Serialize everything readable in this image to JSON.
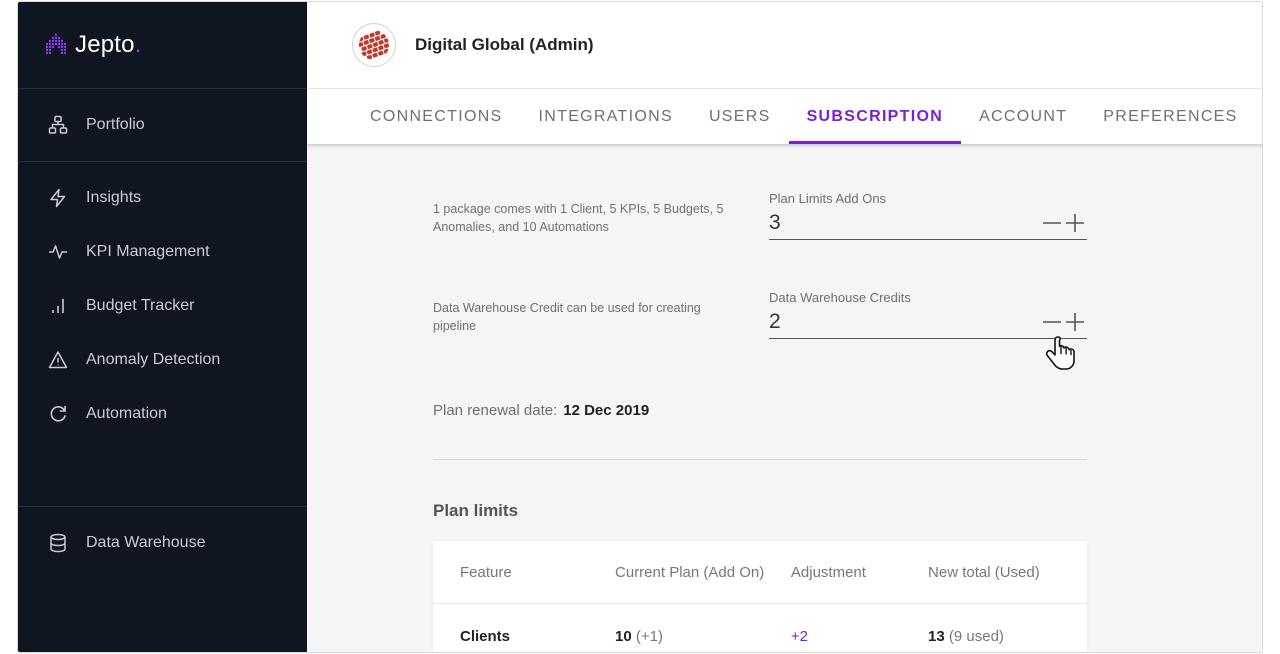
{
  "brand": {
    "name": "Jepto",
    "dot": ".",
    "accent": "#8b3cf2"
  },
  "sidebar": {
    "top_item": {
      "label": "Portfolio",
      "icon": "portfolio-icon"
    },
    "items": [
      {
        "label": "Insights",
        "icon": "lightning-icon"
      },
      {
        "label": "KPI Management",
        "icon": "pulse-icon"
      },
      {
        "label": "Budget Tracker",
        "icon": "bar-chart-icon"
      },
      {
        "label": "Anomaly Detection",
        "icon": "warning-icon"
      },
      {
        "label": "Automation",
        "icon": "refresh-icon"
      }
    ],
    "bottom_item": {
      "label": "Data Warehouse",
      "icon": "database-icon"
    }
  },
  "header": {
    "org_name": "Digital Global (Admin)"
  },
  "tabs": [
    {
      "label": "CONNECTIONS"
    },
    {
      "label": "INTEGRATIONS"
    },
    {
      "label": "USERS"
    },
    {
      "label": "SUBSCRIPTION",
      "active": true
    },
    {
      "label": "ACCOUNT"
    },
    {
      "label": "PREFERENCES"
    }
  ],
  "subscription": {
    "plan_addons": {
      "description": "1 package comes with 1 Client, 5 KPIs, 5 Budgets, 5 Anomalies, and 10 Automations",
      "label": "Plan Limits Add Ons",
      "value": "3"
    },
    "dw_credits": {
      "description": "Data Warehouse Credit can be used for creating pipeline",
      "label": "Data Warehouse Credits",
      "value": "2"
    },
    "renewal_label": "Plan renewal date:",
    "renewal_date": "12 Dec 2019",
    "limits_title": "Plan limits",
    "table": {
      "headers": [
        "Feature",
        "Current Plan (Add On)",
        "Adjustment",
        "New total (Used)"
      ],
      "rows": [
        {
          "feature": "Clients",
          "current": "10",
          "current_addon": "(+1)",
          "adjustment": "+2",
          "new_total": "13",
          "used": "(9 used)"
        }
      ]
    }
  },
  "colors": {
    "sidebar_bg": "#101522",
    "active_tab": "#7b1fd6"
  }
}
